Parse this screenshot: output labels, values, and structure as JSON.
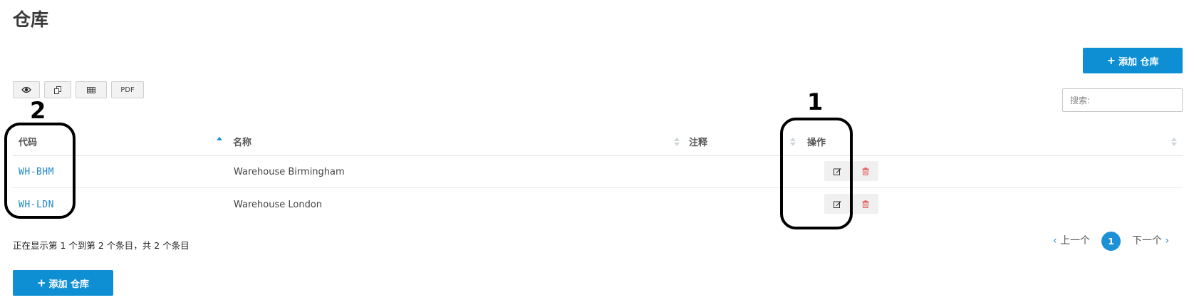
{
  "page": {
    "title": "仓库"
  },
  "actions": {
    "add_label": "添加 仓库",
    "add_icon": "plus-icon"
  },
  "toolbar": {
    "buttons": [
      {
        "icon": "eye-icon"
      },
      {
        "icon": "copy-icon"
      },
      {
        "icon": "table-icon"
      },
      {
        "label": "PDF"
      }
    ]
  },
  "search": {
    "placeholder": "搜索:"
  },
  "table": {
    "columns": [
      "代码",
      "名称",
      "注释",
      "操作"
    ],
    "rows": [
      {
        "code": "WH-BHM",
        "name": "Warehouse Birmingham",
        "note": ""
      },
      {
        "code": "WH-LDN",
        "name": "Warehouse London",
        "note": ""
      }
    ]
  },
  "footer": {
    "info": "正在显示第 1 个到第 2 个条目，共 2 个条目"
  },
  "pagination": {
    "prev_label": "上一个",
    "next_label": "下一个",
    "current_page": "1"
  },
  "annotations": [
    {
      "label": "1"
    },
    {
      "label": "2"
    }
  ],
  "colors": {
    "accent": "#0f8fd3",
    "link": "#1e87c8",
    "delete": "#e25858"
  }
}
